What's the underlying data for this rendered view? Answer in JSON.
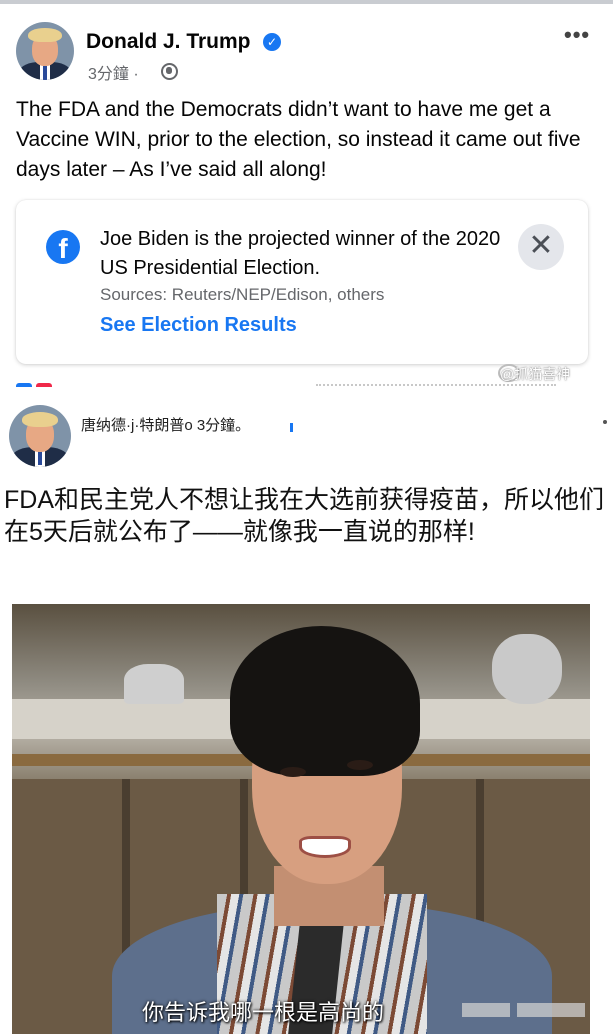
{
  "post": {
    "author": "Donald J. Trump",
    "time": "3分鐘",
    "time_separator": "·",
    "text": "The FDA and the Democrats didn’t want to have me get a Vaccine WIN, prior to the election, so instead it came out five days later – As I’ve said all along!",
    "more": "•••"
  },
  "election_card": {
    "title": "Joe Biden is the projected winner of the 2020 US Presidential Election.",
    "sources": "Sources: Reuters/NEP/Edison, others",
    "link": "See Election Results",
    "close": "✕",
    "fb_letter": "f"
  },
  "watermark": "@抓猫喜神",
  "translated_post": {
    "author_line": "唐纳德·j·特朗普o 3分鐘。",
    "text": "FDA和民主党人不想让我在大选前获得疫苗，所以他们在5天后就公布了——就像我一直说的那样!"
  },
  "meme": {
    "subtitle": "你告诉我哪一根是高尚的"
  },
  "colors": {
    "facebook_blue": "#1877f2",
    "secondary_text": "#65676b",
    "close_bg": "#e4e6eb"
  },
  "icons": {
    "verified": "verified-badge-icon",
    "globe": "globe-icon",
    "facebook": "facebook-icon",
    "close": "close-icon",
    "more": "more-options-icon"
  }
}
